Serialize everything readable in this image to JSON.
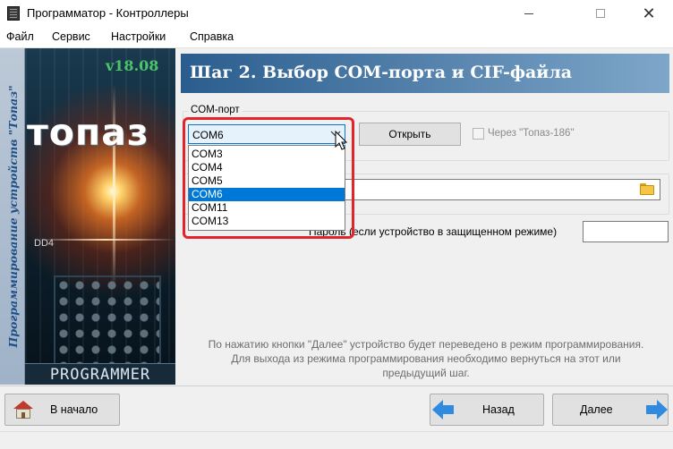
{
  "window": {
    "title": "Программатор - Контроллеры",
    "minimize_glyph": "—",
    "maximize_glyph": "☐",
    "close_glyph": "✕"
  },
  "menu": {
    "items": [
      "Файл",
      "Сервис",
      "Настройки",
      "Справка"
    ]
  },
  "banner": {
    "version": "v18.08",
    "logo": "топаз",
    "vertical_text": "Программирование устройств \"Топаз\"",
    "footer": "PROGRAMMER",
    "chip_label": "DD4"
  },
  "step": {
    "title": "Шаг 2. Выбор COM-порта и CIF-файла"
  },
  "com_port": {
    "group_label": "COM-порт",
    "selected": "COM6",
    "options": [
      "COM3",
      "COM4",
      "COM5",
      "COM6",
      "COM11",
      "COM13"
    ],
    "selected_index": 3,
    "open_button": "Открыть",
    "checkbox_label": "Через \"Топаз-186\"",
    "checkbox_checked": false
  },
  "cif": {
    "path": ""
  },
  "password": {
    "label": "Пароль (если устройство в защищенном режиме)",
    "value": ""
  },
  "info": {
    "lines": [
      "По нажатию кнопки \"Далее\" устройство  будет переведено в режим программирования.",
      "Для выхода из режима программирования необходимо вернуться на этот или",
      "предыдущий шаг."
    ]
  },
  "buttons": {
    "start": "В начало",
    "back": "Назад",
    "next": "Далее"
  },
  "colors": {
    "highlight": "#e3252b",
    "selection": "#0078d7",
    "header_start": "#2a5d8e",
    "header_end": "#7ea6c9",
    "version_text": "#49c56a"
  },
  "icons": {
    "app": "programmer-app-icon",
    "folder": "folder-icon",
    "home": "house-icon",
    "back": "arrow-left-icon",
    "next": "arrow-right-icon",
    "combo": "chevron-down-icon",
    "cursor": "mouse-pointer-icon"
  }
}
